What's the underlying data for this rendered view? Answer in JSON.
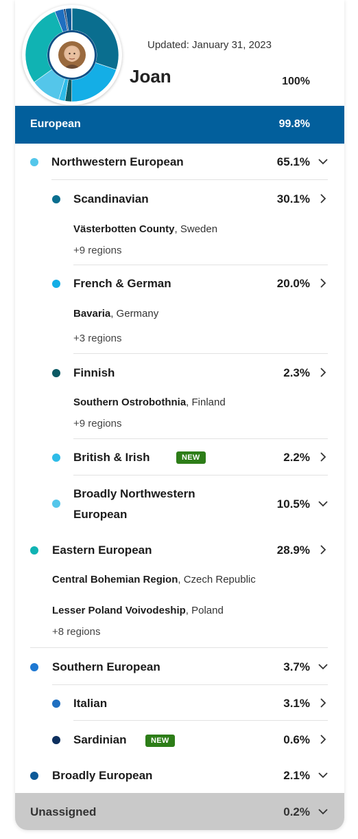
{
  "header": {
    "updated": "Updated: January 31, 2023",
    "name": "Joan",
    "total_percent": "100%"
  },
  "group": {
    "name": "European",
    "percent": "99.8%",
    "color": "#025f9c"
  },
  "chart_segments": [
    {
      "label": "Scandinavian",
      "value": 30.1,
      "color": "#0a6e8f"
    },
    {
      "label": "French & German",
      "value": 20.0,
      "color": "#14aee6"
    },
    {
      "label": "Finnish",
      "value": 2.3,
      "color": "#0c5a64"
    },
    {
      "label": "British & Irish",
      "value": 2.2,
      "color": "#2ebce8"
    },
    {
      "label": "Broadly Northwestern European",
      "value": 10.5,
      "color": "#54c6ea"
    },
    {
      "label": "Eastern European",
      "value": 28.9,
      "color": "#10b3b3"
    },
    {
      "label": "Italian",
      "value": 3.1,
      "color": "#1f6fc0"
    },
    {
      "label": "Sardinian",
      "value": 0.6,
      "color": "#0d2f5e"
    },
    {
      "label": "Broadly European",
      "value": 2.1,
      "color": "#0d5a98"
    },
    {
      "label": "Unassigned",
      "value": 0.2,
      "color": "#9a9a9a"
    }
  ],
  "rows": {
    "nw": {
      "name": "Northwestern European",
      "percent": "65.1%",
      "color": "#54c6ea",
      "chevron": "chevron-down-icon"
    },
    "scand": {
      "name": "Scandinavian",
      "percent": "30.1%",
      "color": "#0a6e8f",
      "chevron": "chevron-right-icon",
      "region_bold": "Västerbotten County",
      "region_rest": ", Sweden",
      "more": "+9 regions"
    },
    "fg": {
      "name": "French & German",
      "percent": "20.0%",
      "color": "#14aee6",
      "chevron": "chevron-right-icon",
      "region_bold": "Bavaria",
      "region_rest": ", Germany",
      "more": "+3 regions"
    },
    "fin": {
      "name": "Finnish",
      "percent": "2.3%",
      "color": "#0c5a64",
      "chevron": "chevron-right-icon",
      "region_bold": "Southern Ostrobothnia",
      "region_rest": ", Finland",
      "more": "+9 regions"
    },
    "bi": {
      "name": "British & Irish",
      "badge": "NEW",
      "percent": "2.2%",
      "color": "#2ebce8",
      "chevron": "chevron-right-icon"
    },
    "bnw": {
      "name_line1": "Broadly Northwestern",
      "name_line2": "European",
      "percent": "10.5%",
      "color": "#54c6ea",
      "chevron": "chevron-down-icon"
    },
    "east": {
      "name": "Eastern European",
      "percent": "28.9%",
      "color": "#10b3b3",
      "chevron": "chevron-right-icon",
      "region1_bold": "Central Bohemian Region",
      "region1_rest": ", Czech Republic",
      "region2_bold": "Lesser Poland Voivodeship",
      "region2_rest": ", Poland",
      "more": "+8 regions"
    },
    "south": {
      "name": "Southern European",
      "percent": "3.7%",
      "color": "#1e78d2",
      "chevron": "chevron-down-icon"
    },
    "ita": {
      "name": "Italian",
      "percent": "3.1%",
      "color": "#1f6fc0",
      "chevron": "chevron-right-icon"
    },
    "sard": {
      "name": "Sardinian",
      "badge": "NEW",
      "percent": "0.6%",
      "color": "#0d2f5e",
      "chevron": "chevron-right-icon"
    },
    "broad": {
      "name": "Broadly European",
      "percent": "2.1%",
      "color": "#0d5a98",
      "chevron": "chevron-down-icon"
    }
  },
  "unassigned": {
    "name": "Unassigned",
    "percent": "0.2%",
    "chevron": "chevron-down-icon"
  }
}
